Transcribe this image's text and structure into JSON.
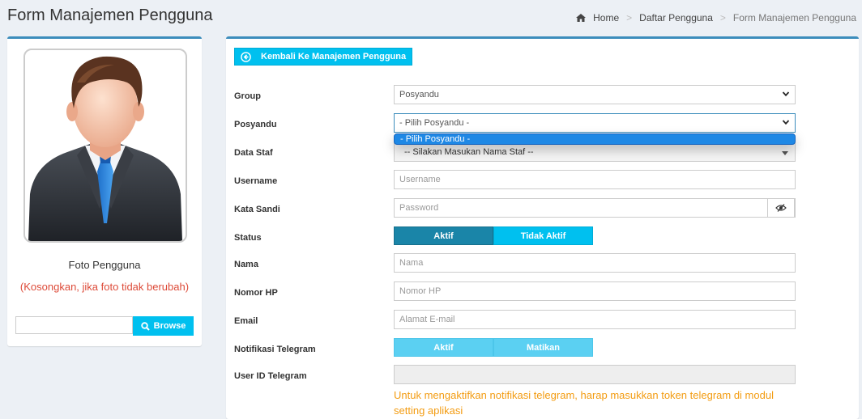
{
  "page": {
    "title": "Form Manajemen Pengguna"
  },
  "breadcrumb": {
    "home": "Home",
    "list": "Daftar Pengguna",
    "current": "Form Manajemen Pengguna"
  },
  "photo": {
    "label": "Foto Pengguna",
    "hint": "(Kosongkan, jika foto tidak berubah)",
    "browse_label": "Browse"
  },
  "form": {
    "back_label": "Kembali Ke Manajemen Pengguna",
    "group": {
      "label": "Group",
      "value": "Posyandu"
    },
    "posyandu": {
      "label": "Posyandu",
      "value": "- Pilih Posyandu -",
      "options": [
        "- Pilih Posyandu -"
      ]
    },
    "staf": {
      "label": "Data Staf",
      "value": "-- Silakan Masukan Nama Staf --"
    },
    "username": {
      "label": "Username",
      "placeholder": "Username"
    },
    "password": {
      "label": "Kata Sandi",
      "placeholder": "Password"
    },
    "status": {
      "label": "Status",
      "on": "Aktif",
      "off": "Tidak Aktif"
    },
    "nama": {
      "label": "Nama",
      "placeholder": "Nama"
    },
    "hp": {
      "label": "Nomor HP",
      "placeholder": "Nomor HP"
    },
    "email": {
      "label": "Email",
      "placeholder": "Alamat E-mail"
    },
    "telegram": {
      "label": "Notifikasi Telegram",
      "on": "Aktif",
      "off": "Matikan"
    },
    "telegram_id": {
      "label": "User ID Telegram"
    },
    "help": "Untuk mengaktifkan notifikasi telegram, harap masukkan token telegram di modul setting aplikasi"
  }
}
